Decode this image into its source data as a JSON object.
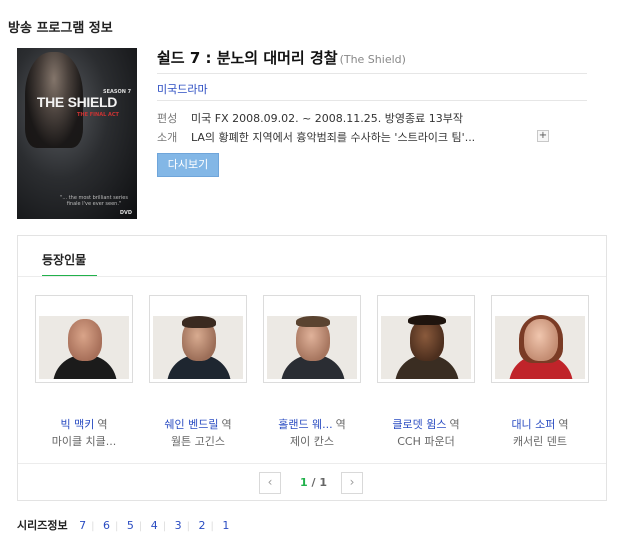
{
  "section_title": "방송 프로그램 정보",
  "poster": {
    "title": "THE SHIELD",
    "season_label": "SEASON 7",
    "tagline": "THE FINAL ACT",
    "quote": "\"... the most brilliant series finale I've ever seen.\"",
    "format": "DVD"
  },
  "program": {
    "title": "쉴드 7 : 분노의 대머리 경찰",
    "original_title": "(The Shield)",
    "genre": "미국드라마",
    "broadcast_label": "편성",
    "broadcast_value": "미국 FX 2008.09.02. ~ 2008.11.25. 방영종료 13부작",
    "synopsis_label": "소개",
    "synopsis_value": "LA의 황폐한 지역에서 흉악범죄를 수사하는 '스트라이크 팀'...",
    "more_symbol": "+",
    "rewatch_label": "다시보기"
  },
  "cast": {
    "tab_label": "등장인물",
    "role_suffix": "역",
    "members": [
      {
        "role": "빅 맥키",
        "actor": "마이클 치클..."
      },
      {
        "role": "쉐인 벤드릴",
        "actor": "월튼 고긴스"
      },
      {
        "role": "홀랜드 웨...",
        "actor": "제이 칸스"
      },
      {
        "role": "클로뎃 윔스",
        "actor": "CCH 파운더"
      },
      {
        "role": "대니 소퍼",
        "actor": "캐서린 덴트"
      }
    ],
    "pagination": {
      "current": "1",
      "separator": "/",
      "total": "1",
      "prev_icon": "‹",
      "next_icon": "›"
    }
  },
  "series": {
    "label": "시리즈정보",
    "episodes": [
      "7",
      "6",
      "5",
      "4",
      "3",
      "2",
      "1"
    ]
  },
  "colors": {
    "link_blue": "#2a4cc2",
    "accent_green": "#21b14b",
    "button_blue": "#83b7e6"
  }
}
